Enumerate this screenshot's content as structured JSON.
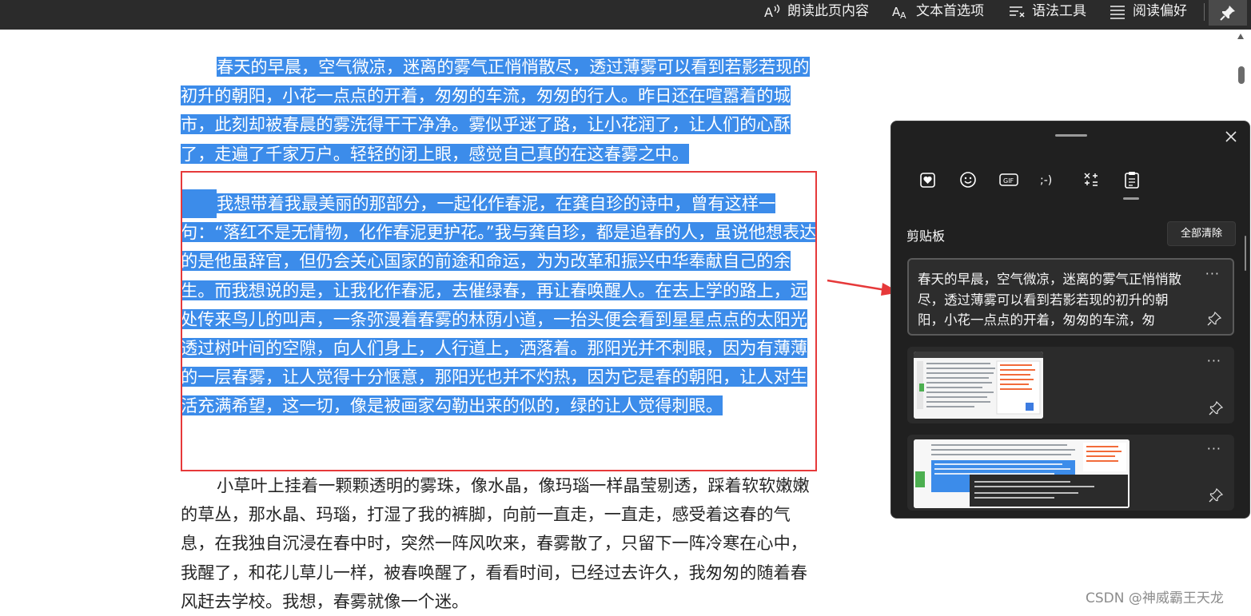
{
  "toolbar": {
    "read_aloud": "朗读此页内容",
    "text_prefs": "文本首选项",
    "grammar_tools": "语法工具",
    "reading_prefs": "阅读偏好"
  },
  "article": {
    "p1_sel": "春天的早晨，空气微凉，迷离的雾气正悄悄散尽，透过薄雾可以看到若影若现的初升的朝阳，小花一点点的开着，匆匆的车流，匆匆的行人。昨日还在喧嚣着的城市，此刻却被春晨的雾洗得干干净净。雾似乎迷了路，让小花润了，让人们的心酥了，走遍了千家万户。轻轻的闭上眼，感觉自己真的在这春雾之中。",
    "p2_sel": "我想带着我最美丽的那部分，一起化作春泥，在龚自珍的诗中，曾有这样一句：“落红不是无情物，化作春泥更护花。”我与龚自珍，都是追春的人，虽说他想表达的是他虽辞官，但仍会关心国家的前途和命运，为为改革和振兴中华奉献自己的余生。而我想说的是，让我化作春泥，去催绿春，再让春唤醒人。在去上学的路上，远处传来鸟儿的叫声，一条弥漫着春雾的林荫小道，一抬头便会看到星星点点的太阳光透过树叶间的空隙，向人们身上，人行道上，洒落着。那阳光并不刺眼，因为有薄薄的一层春雾，让人觉得十分惬意，那阳光也并不灼热，因为它是春的朝阳，让人对生活充满希望，这一切，像是被画家勾勒出来的似的，绿的让人觉得刺眼。",
    "p3": "小草叶上挂着一颗颗透明的雾珠，像水晶，像玛瑙一样晶莹剔透，踩着软软嫩嫩的草丛，那水晶、玛瑙，打湿了我的裤脚，向前一直走，一直走，感受着这春的气息，在我独自沉浸在春中时，突然一阵风吹来，春雾散了，只留下一阵冷寒在心中，我醒了，和花儿草儿一样，被春唤醒了，看看时间，已经过去许久，我匆匆的随着春风赶去学校。我想，春雾就像一个迷。"
  },
  "clipboard": {
    "title": "剪贴板",
    "clear_all": "全部清除",
    "tabs": [
      "favorites-icon",
      "emoji-icon",
      "gif-icon",
      "kaomoji-icon",
      "symbols-icon",
      "clipboard-icon"
    ],
    "tab_gif_label": "GIF",
    "tab_kaomoji_label": ";-)",
    "more_label": "···",
    "items": [
      {
        "text": "春天的早晨，空气微凉，迷离的雾气正悄悄散尽，透过薄雾可以看到若影若现的初升的朝阳，小花一点点的开着，匆匆的车流，匆"
      }
    ]
  },
  "watermark": "CSDN @神威霸王天龙",
  "colors": {
    "selection": "#3c8cea",
    "annotation": "#e6393a",
    "panel_bg": "#202020",
    "toolbar_bg": "#2b2b2b"
  }
}
